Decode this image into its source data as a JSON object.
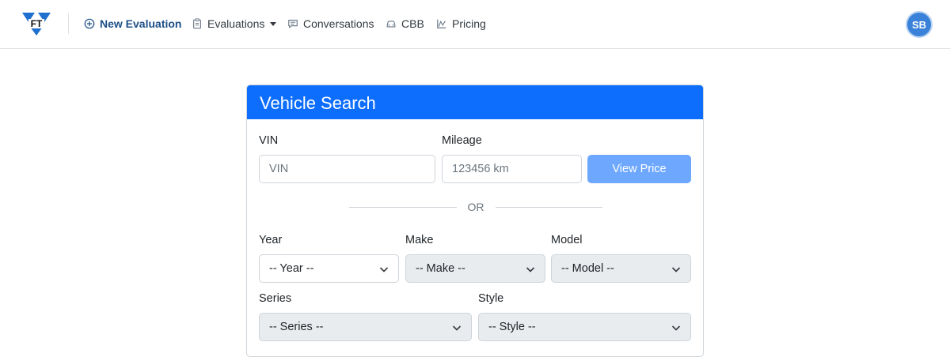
{
  "nav": {
    "logo_text": "FT",
    "items": [
      {
        "label": "New Evaluation",
        "icon": "plus-circle-icon"
      },
      {
        "label": "Evaluations",
        "icon": "clipboard-icon"
      },
      {
        "label": "Conversations",
        "icon": "chat-icon"
      },
      {
        "label": "CBB",
        "icon": "car-icon"
      },
      {
        "label": "Pricing",
        "icon": "chart-icon"
      }
    ],
    "avatar_initials": "SB"
  },
  "card": {
    "title": "Vehicle Search",
    "vin_label": "VIN",
    "vin_placeholder": "VIN",
    "mileage_label": "Mileage",
    "mileage_placeholder": "123456 km",
    "view_price_label": "View Price",
    "or_text": "OR",
    "year_label": "Year",
    "year_value": "-- Year --",
    "make_label": "Make",
    "make_value": "-- Make --",
    "model_label": "Model",
    "model_value": "-- Model --",
    "series_label": "Series",
    "series_value": "-- Series --",
    "style_label": "Style",
    "style_value": "-- Style --"
  },
  "colors": {
    "primary": "#0d6efd",
    "primary_light": "#6ea8fe",
    "active_nav": "#1e4f87",
    "avatar": "#3a82d9"
  }
}
